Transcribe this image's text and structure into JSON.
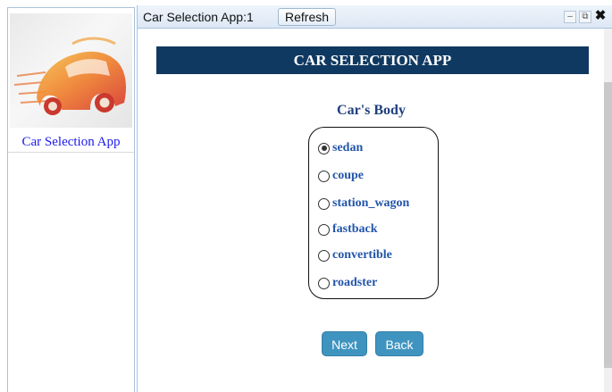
{
  "sidebar": {
    "app_label": "Car Selection App"
  },
  "window": {
    "title": "Car Selection App:1",
    "refresh_label": "Refresh"
  },
  "main": {
    "header": "CAR SELECTION APP",
    "section_title": "Car's Body",
    "options": [
      {
        "label": "sedan",
        "checked": true
      },
      {
        "label": "coupe",
        "checked": false
      },
      {
        "label": "station_wagon",
        "checked": false
      },
      {
        "label": "fastback",
        "checked": false
      },
      {
        "label": "convertible",
        "checked": false
      },
      {
        "label": "roadster",
        "checked": false
      }
    ],
    "next_label": "Next",
    "back_label": "Back"
  },
  "colors": {
    "header_bg": "#103961",
    "button_bg": "#3f94bf",
    "option_text": "#2255aa",
    "sidebar_link": "#1a1aee"
  },
  "icons": [
    "car-logo-icon",
    "minimize-icon",
    "popout-icon",
    "close-icon"
  ]
}
